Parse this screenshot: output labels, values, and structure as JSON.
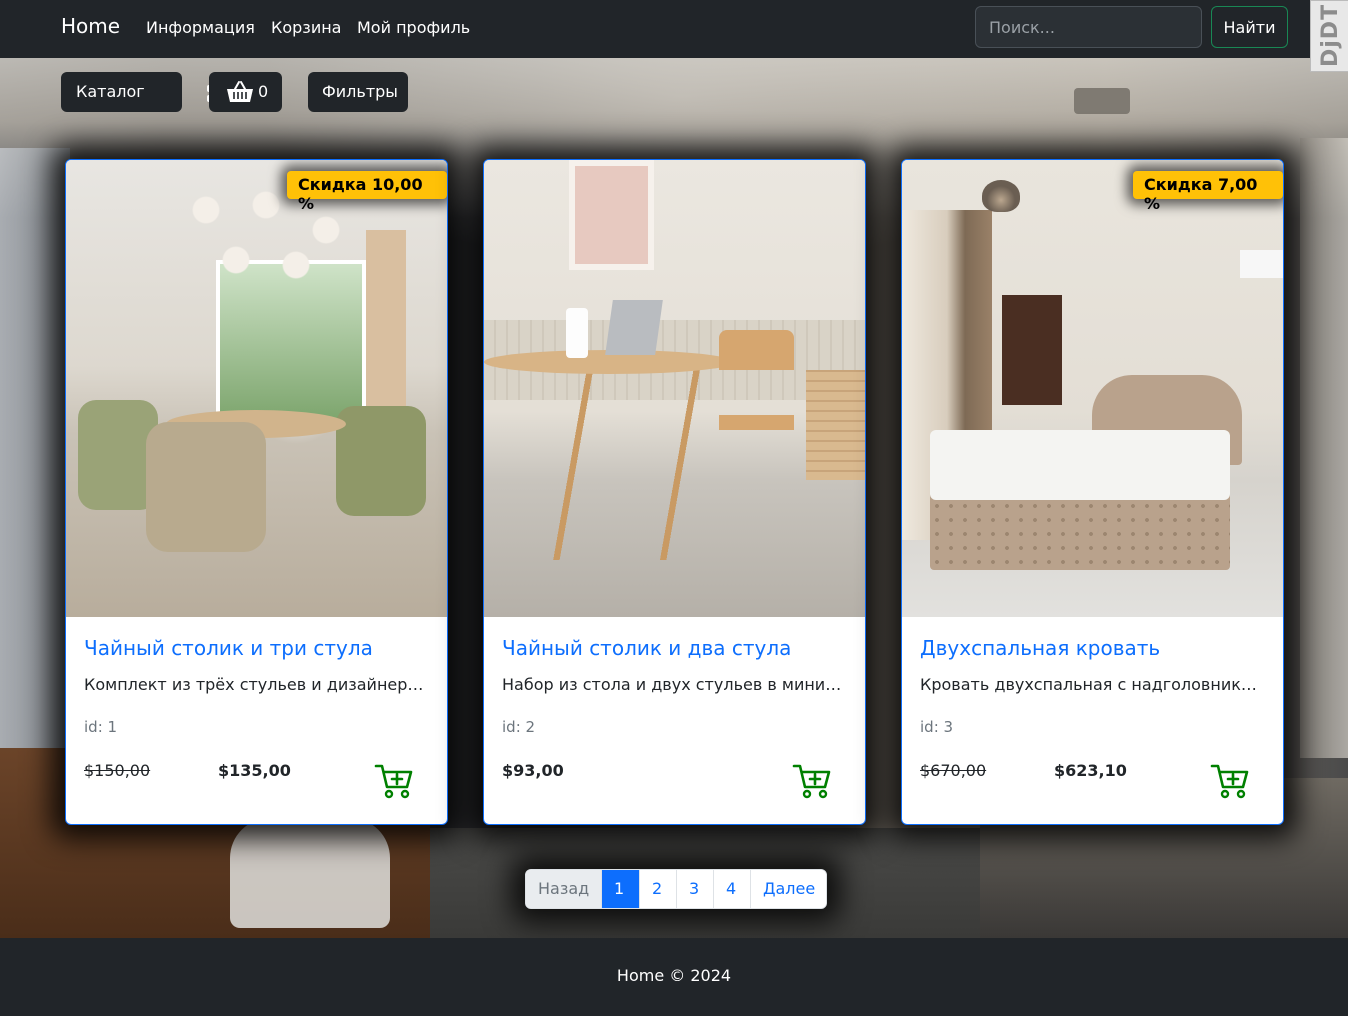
{
  "navbar": {
    "brand": "Home",
    "links": [
      "Информация",
      "Корзина",
      "Мой профиль"
    ],
    "search_placeholder": "Поиск...",
    "search_button": "Найти",
    "debug_toolbar": "DjDT"
  },
  "toolbar": {
    "catalog_label": "Каталог",
    "cart_count": "0",
    "filters_label": "Фильтры"
  },
  "products": [
    {
      "badge": "Скидка 10,00 %",
      "title": "Чайный столик и три стула",
      "description": "Комплект из трёх стульев и дизайнерского столика",
      "id_text": "id: 1",
      "old_price": "$150,00",
      "price": "$135,00"
    },
    {
      "badge": "",
      "title": "Чайный столик и два стула",
      "description": "Набор из стола и двух стульев в минималистичном стиле",
      "id_text": "id: 2",
      "old_price": "",
      "price": "$93,00"
    },
    {
      "badge": "Скидка 7,00 %",
      "title": "Двухспальная кровать",
      "description": "Кровать двухспальная с надголовником и подъёмным механизмом",
      "id_text": "id: 3",
      "old_price": "$670,00",
      "price": "$623,10"
    }
  ],
  "pagination": {
    "prev": "Назад",
    "pages": [
      "1",
      "2",
      "3",
      "4"
    ],
    "active": "1",
    "next": "Далее"
  },
  "footer": {
    "text": "Home © 2024"
  },
  "colors": {
    "navbar_bg": "#212529",
    "link_blue": "#0d6efd",
    "badge_yellow": "#ffc107",
    "cart_green": "#008000",
    "search_border": "#198754"
  },
  "icons": {
    "catalog": "grid-icon",
    "cart": "basket-icon",
    "add_to_cart": "cart-plus-icon"
  }
}
